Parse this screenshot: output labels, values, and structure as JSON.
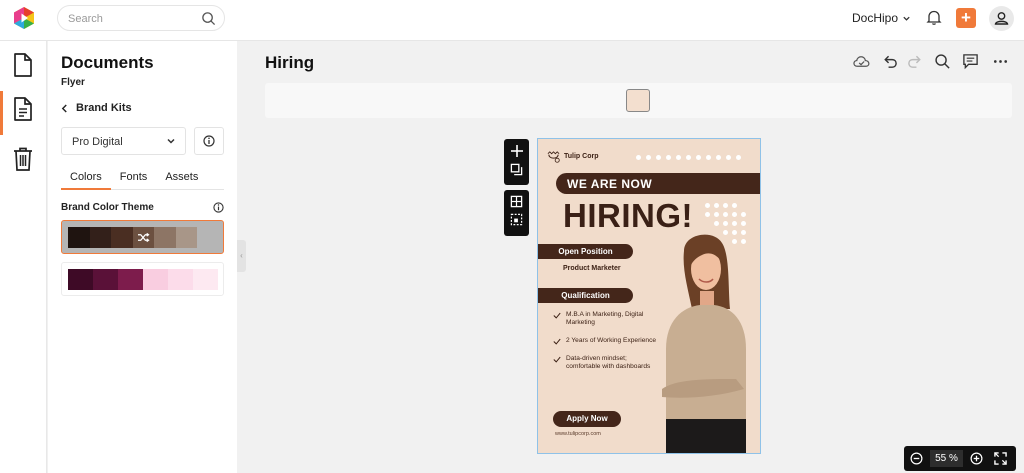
{
  "topbar": {
    "search_placeholder": "Search",
    "account_name": "DocHipo",
    "accent_color": "#f07a3a"
  },
  "rail": {
    "items": [
      {
        "icon": "document-icon"
      },
      {
        "icon": "file-text-icon",
        "active": true
      },
      {
        "icon": "trash-icon"
      }
    ]
  },
  "panel": {
    "title": "Documents",
    "subtitle": "Flyer",
    "back_label": "Brand Kits",
    "kit_value": "Pro Digital",
    "tabs": [
      "Colors",
      "Fonts",
      "Assets"
    ],
    "active_tab": "Colors",
    "theme_label": "Brand Color Theme",
    "palettes": [
      {
        "selected": true,
        "colors": [
          "#1f1410",
          "#33201a",
          "#4a2e22",
          "#6c5040",
          "#8d7565",
          "#a89688",
          "#b5b5b5"
        ]
      },
      {
        "selected": false,
        "colors": [
          "#3e0a26",
          "#5a1138",
          "#7d1c4c",
          "#f9cde0",
          "#fcdcea",
          "#fde9f1"
        ]
      }
    ]
  },
  "main": {
    "title": "Hiring",
    "selected_color": "#f3dfcf"
  },
  "flyer": {
    "brand": "Tulip Corp",
    "banner": "WE ARE NOW",
    "headline": "HIRING!",
    "open_position_label": "Open Position",
    "position": "Product Marketer",
    "qualification_label": "Qualification",
    "qualifications": [
      "M.B.A in Marketing, Digital Marketing",
      "2 Years of Working Experience",
      "Data-driven mindset; comfortable with dashboards"
    ],
    "cta": "Apply Now",
    "website": "www.tulipcorp.com",
    "background": "#f1dccb",
    "dark": "#44261a"
  },
  "zoom": {
    "value": "55",
    "unit": "%"
  }
}
